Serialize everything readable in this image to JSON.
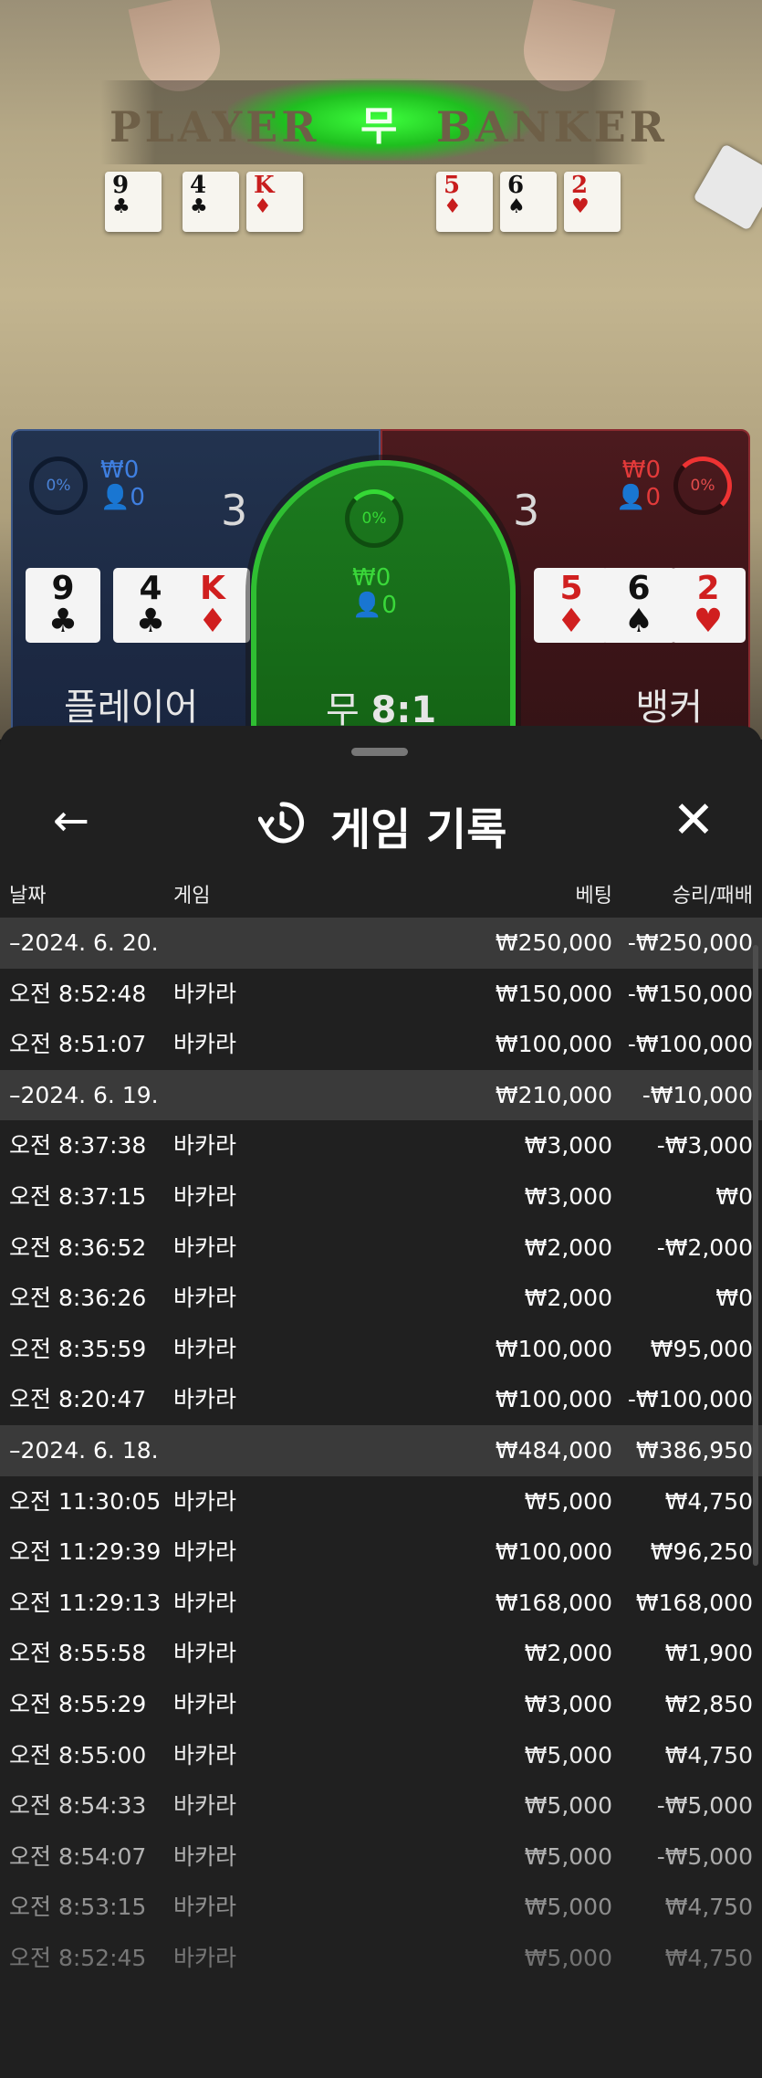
{
  "table": {
    "felt_player": "PLAYER",
    "felt_tie": "무",
    "felt_banker": "BANKER",
    "player_cards": [
      {
        "rank": "9",
        "suit": "♣",
        "color": "black"
      },
      {
        "rank": "4",
        "suit": "♣",
        "color": "black"
      },
      {
        "rank": "K",
        "suit": "♦",
        "color": "red"
      }
    ],
    "banker_cards": [
      {
        "rank": "5",
        "suit": "♦",
        "color": "red"
      },
      {
        "rank": "6",
        "suit": "♠",
        "color": "black"
      },
      {
        "rank": "2",
        "suit": "♥",
        "color": "red"
      }
    ]
  },
  "board": {
    "player": {
      "pct": "0%",
      "amount": "₩0",
      "count": "0",
      "score": "3",
      "label": "플레이어"
    },
    "tie": {
      "pct": "0%",
      "amount": "₩0",
      "count": "0",
      "label": "무",
      "payout": "8:1"
    },
    "banker": {
      "pct": "0%",
      "amount": "₩0",
      "count": "0",
      "score": "3",
      "label": "뱅커"
    },
    "colors": {
      "player": "#3f7fe0",
      "banker": "#e23a3a",
      "tie": "#3ad83a"
    }
  },
  "history": {
    "title": "게임 기록",
    "icons": {
      "back": "arrow-left-icon",
      "history": "history-icon",
      "close": "close-icon"
    },
    "columns": {
      "date": "날짜",
      "game": "게임",
      "bet": "베팅",
      "result": "승리/패배"
    },
    "rows": [
      {
        "type": "date",
        "date": "–2024. 6. 20.",
        "game": "",
        "bet": "₩250,000",
        "result": "-₩250,000"
      },
      {
        "type": "entry",
        "date": "오전 8:52:48",
        "game": "바카라",
        "bet": "₩150,000",
        "result": "-₩150,000"
      },
      {
        "type": "entry",
        "date": "오전 8:51:07",
        "game": "바카라",
        "bet": "₩100,000",
        "result": "-₩100,000"
      },
      {
        "type": "date",
        "date": "–2024. 6. 19.",
        "game": "",
        "bet": "₩210,000",
        "result": "-₩10,000"
      },
      {
        "type": "entry",
        "date": "오전 8:37:38",
        "game": "바카라",
        "bet": "₩3,000",
        "result": "-₩3,000"
      },
      {
        "type": "entry",
        "date": "오전 8:37:15",
        "game": "바카라",
        "bet": "₩3,000",
        "result": "₩0"
      },
      {
        "type": "entry",
        "date": "오전 8:36:52",
        "game": "바카라",
        "bet": "₩2,000",
        "result": "-₩2,000"
      },
      {
        "type": "entry",
        "date": "오전 8:36:26",
        "game": "바카라",
        "bet": "₩2,000",
        "result": "₩0"
      },
      {
        "type": "entry",
        "date": "오전 8:35:59",
        "game": "바카라",
        "bet": "₩100,000",
        "result": "₩95,000"
      },
      {
        "type": "entry",
        "date": "오전 8:20:47",
        "game": "바카라",
        "bet": "₩100,000",
        "result": "-₩100,000"
      },
      {
        "type": "date",
        "date": "–2024. 6. 18.",
        "game": "",
        "bet": "₩484,000",
        "result": "₩386,950"
      },
      {
        "type": "entry",
        "date": "오전 11:30:05",
        "game": "바카라",
        "bet": "₩5,000",
        "result": "₩4,750"
      },
      {
        "type": "entry",
        "date": "오전 11:29:39",
        "game": "바카라",
        "bet": "₩100,000",
        "result": "₩96,250"
      },
      {
        "type": "entry",
        "date": "오전 11:29:13",
        "game": "바카라",
        "bet": "₩168,000",
        "result": "₩168,000"
      },
      {
        "type": "entry",
        "date": "오전 8:55:58",
        "game": "바카라",
        "bet": "₩2,000",
        "result": "₩1,900"
      },
      {
        "type": "entry",
        "date": "오전 8:55:29",
        "game": "바카라",
        "bet": "₩3,000",
        "result": "₩2,850"
      },
      {
        "type": "entry",
        "date": "오전 8:55:00",
        "game": "바카라",
        "bet": "₩5,000",
        "result": "₩4,750"
      },
      {
        "type": "entry",
        "date": "오전 8:54:33",
        "game": "바카라",
        "bet": "₩5,000",
        "result": "-₩5,000"
      },
      {
        "type": "entry",
        "date": "오전 8:54:07",
        "game": "바카라",
        "bet": "₩5,000",
        "result": "-₩5,000"
      },
      {
        "type": "entry",
        "date": "오전 8:53:15",
        "game": "바카라",
        "bet": "₩5,000",
        "result": "₩4,750"
      },
      {
        "type": "entry",
        "date": "오전 8:52:45",
        "game": "바카라",
        "bet": "₩5,000",
        "result": "₩4,750"
      }
    ]
  }
}
